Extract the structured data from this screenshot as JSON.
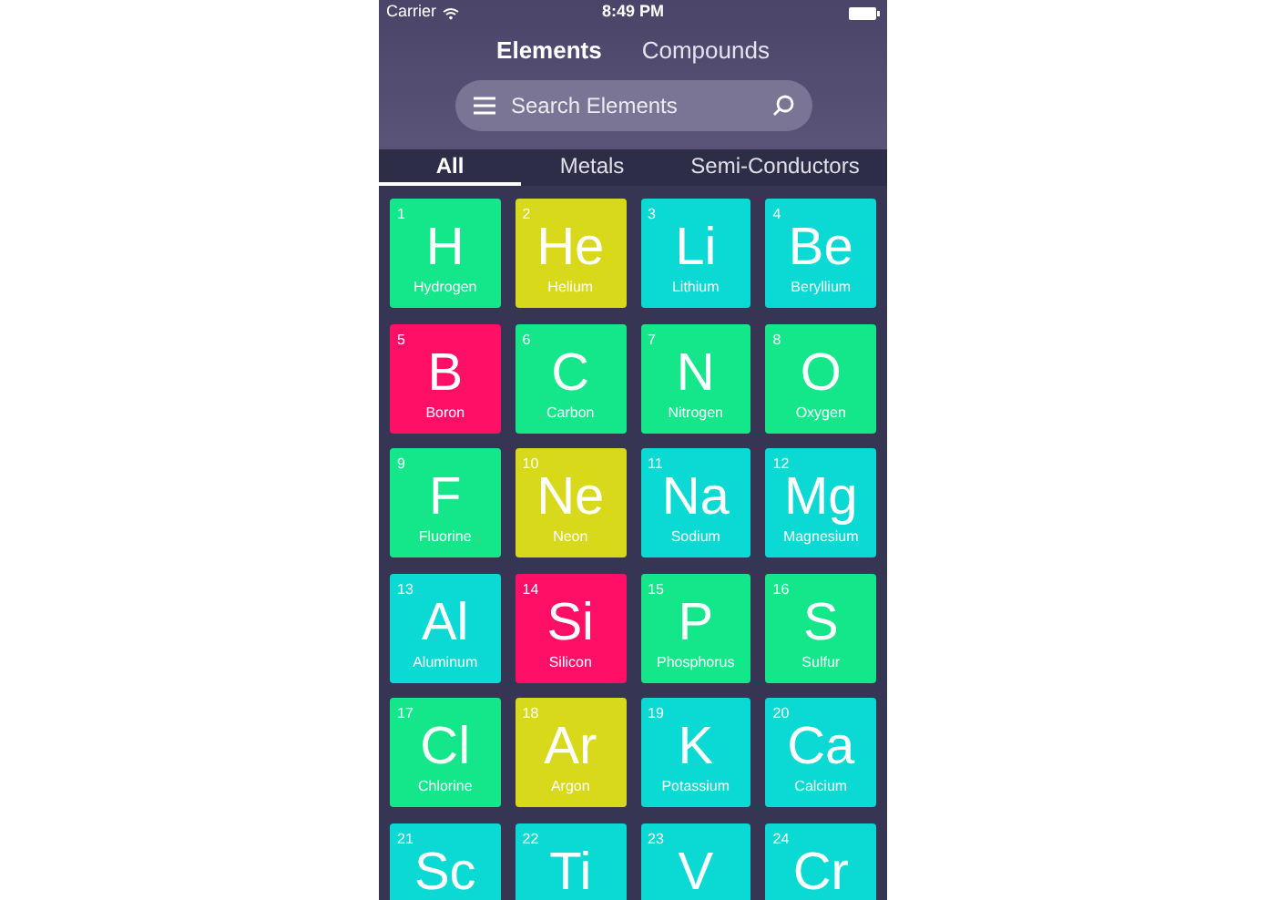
{
  "status_bar": {
    "carrier": "Carrier",
    "time": "8:49 PM"
  },
  "top_tabs": [
    {
      "label": "Elements",
      "selected": true
    },
    {
      "label": "Compounds",
      "selected": false
    }
  ],
  "search": {
    "placeholder": "Search Elements"
  },
  "category_tabs": [
    {
      "label": "All",
      "selected": true
    },
    {
      "label": "Metals",
      "selected": false
    },
    {
      "label": "Semi-Conductors",
      "selected": false
    }
  ],
  "elements": [
    {
      "number": "1",
      "symbol": "H",
      "name": "Hydrogen",
      "color": "#14e68a"
    },
    {
      "number": "2",
      "symbol": "He",
      "name": "Helium",
      "color": "#d9d91c"
    },
    {
      "number": "3",
      "symbol": "Li",
      "name": "Lithium",
      "color": "#0bd9d4"
    },
    {
      "number": "4",
      "symbol": "Be",
      "name": "Beryllium",
      "color": "#0bd9d4"
    },
    {
      "number": "5",
      "symbol": "B",
      "name": "Boron",
      "color": "#ff0f66"
    },
    {
      "number": "6",
      "symbol": "C",
      "name": "Carbon",
      "color": "#14e68a"
    },
    {
      "number": "7",
      "symbol": "N",
      "name": "Nitrogen",
      "color": "#14e68a"
    },
    {
      "number": "8",
      "symbol": "O",
      "name": "Oxygen",
      "color": "#14e68a"
    },
    {
      "number": "9",
      "symbol": "F",
      "name": "Fluorine",
      "color": "#14e68a"
    },
    {
      "number": "10",
      "symbol": "Ne",
      "name": "Neon",
      "color": "#d9d91c"
    },
    {
      "number": "11",
      "symbol": "Na",
      "name": "Sodium",
      "color": "#0bd9d4"
    },
    {
      "number": "12",
      "symbol": "Mg",
      "name": "Magnesium",
      "color": "#0bd9d4"
    },
    {
      "number": "13",
      "symbol": "Al",
      "name": "Aluminum",
      "color": "#0bd9d4"
    },
    {
      "number": "14",
      "symbol": "Si",
      "name": "Silicon",
      "color": "#ff0f66"
    },
    {
      "number": "15",
      "symbol": "P",
      "name": "Phosphorus",
      "color": "#14e68a"
    },
    {
      "number": "16",
      "symbol": "S",
      "name": "Sulfur",
      "color": "#14e68a"
    },
    {
      "number": "17",
      "symbol": "Cl",
      "name": "Chlorine",
      "color": "#14e68a"
    },
    {
      "number": "18",
      "symbol": "Ar",
      "name": "Argon",
      "color": "#d9d91c"
    },
    {
      "number": "19",
      "symbol": "K",
      "name": "Potassium",
      "color": "#0bd9d4"
    },
    {
      "number": "20",
      "symbol": "Ca",
      "name": "Calcium",
      "color": "#0bd9d4"
    },
    {
      "number": "21",
      "symbol": "Sc",
      "color": "#0bd9d4"
    },
    {
      "number": "22",
      "symbol": "Ti",
      "color": "#0bd9d4"
    },
    {
      "number": "23",
      "symbol": "V",
      "color": "#0bd9d4"
    },
    {
      "number": "24",
      "symbol": "Cr",
      "color": "#0bd9d4"
    }
  ]
}
